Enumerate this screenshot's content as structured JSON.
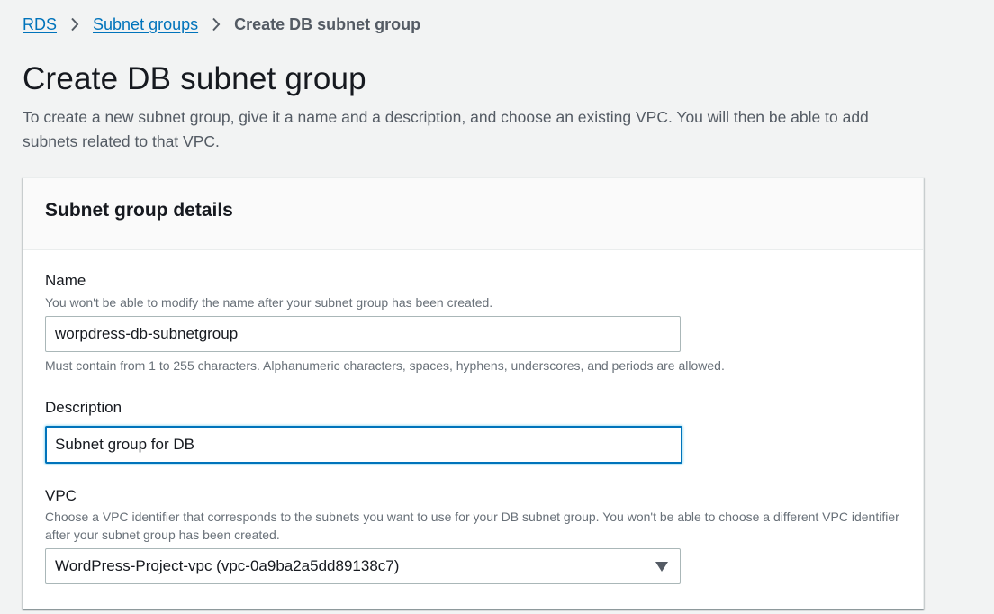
{
  "breadcrumb": {
    "items": [
      "RDS",
      "Subnet groups"
    ],
    "current": "Create DB subnet group"
  },
  "page": {
    "title": "Create DB subnet group",
    "description": "To create a new subnet group, give it a name and a description, and choose an existing VPC. You will then be able to add subnets related to that VPC."
  },
  "panel": {
    "title": "Subnet group details",
    "name": {
      "label": "Name",
      "hint": "You won't be able to modify the name after your subnet group has been created.",
      "value": "worpdress-db-subnetgroup",
      "constraint": "Must contain from 1 to 255 characters. Alphanumeric characters, spaces, hyphens, underscores, and periods are allowed."
    },
    "description": {
      "label": "Description",
      "value": "Subnet group for DB"
    },
    "vpc": {
      "label": "VPC",
      "hint": "Choose a VPC identifier that corresponds to the subnets you want to use for your DB subnet group. You won't be able to choose a different VPC identifier after your subnet group has been created.",
      "selected": "WordPress-Project-vpc (vpc-0a9ba2a5dd89138c7)"
    }
  },
  "colors": {
    "link": "#0073bb",
    "focus": "#0073bb",
    "background": "#f2f3f3"
  },
  "icons": {
    "separator": "chevron-right-icon",
    "dropdown": "caret-down-icon"
  }
}
